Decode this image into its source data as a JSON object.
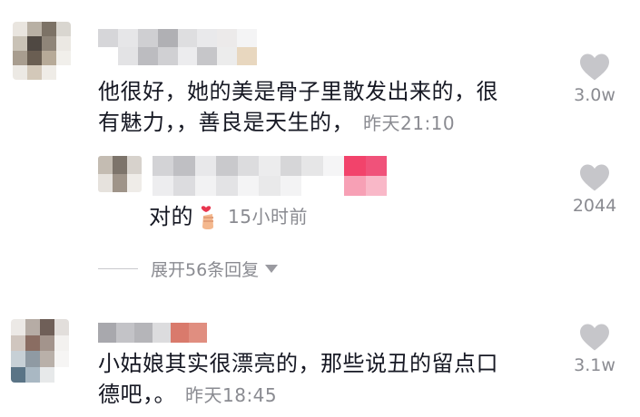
{
  "comments": [
    {
      "text_line1": "他很好，她的美是骨子里散发出来的，很",
      "text_line2": "有魅力，，善良是天生的，",
      "time": "昨天21:10",
      "likes": "3.0w",
      "expand_label": "展开56条回复"
    },
    {
      "text": "对的",
      "emoji_icon": "finger-heart-emoji",
      "time": "15小时前",
      "likes": "2044"
    },
    {
      "text_line1": "小姑娘其实很漂亮的，那些说丑的留点口",
      "text_line2": "德吧，。",
      "time": "昨天18:45",
      "likes": "3.1w"
    }
  ],
  "icons": {
    "like": "heart-icon"
  },
  "colors": {
    "text": "#161823",
    "muted": "#8a8b91",
    "heart": "#c6c6ca",
    "accent": "#f2436b"
  }
}
